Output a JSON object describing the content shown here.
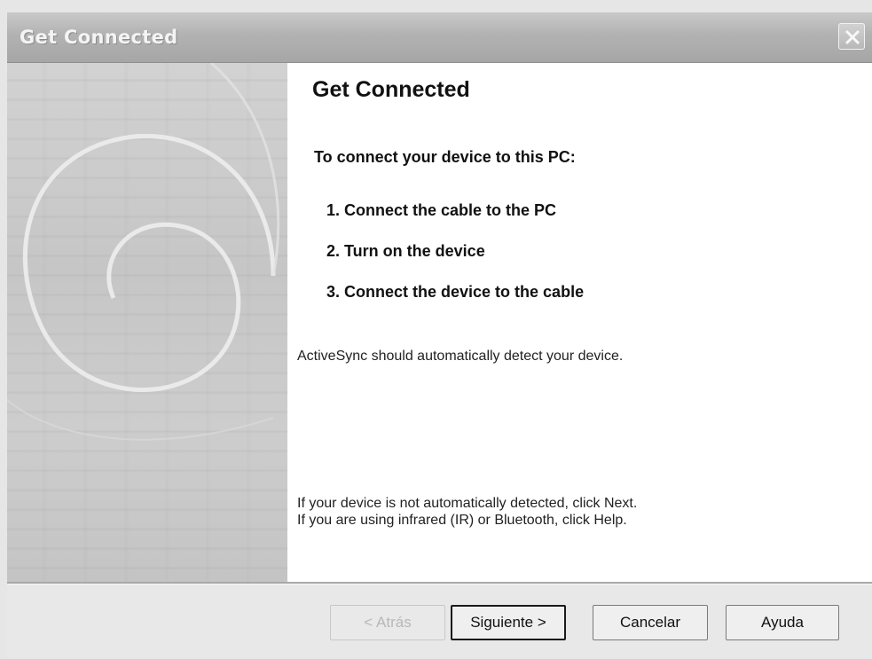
{
  "window": {
    "title": "Get Connected"
  },
  "content": {
    "heading": "Get Connected",
    "intro": "To connect your device to this PC:",
    "steps": [
      "1. Connect the cable to the PC",
      "2. Turn on the device",
      "3. Connect the device to the cable"
    ],
    "detect_text": "ActiveSync should automatically detect your device.",
    "note_line1": "If your device is not automatically detected, click Next.",
    "note_line2": "If you are using infrared (IR) or Bluetooth, click Help."
  },
  "buttons": {
    "back": "< Atrás",
    "next": "Siguiente >",
    "cancel": "Cancelar",
    "help": "Ayuda"
  },
  "icons": {
    "close": "close-icon",
    "side_art": "swirl-graphic"
  }
}
